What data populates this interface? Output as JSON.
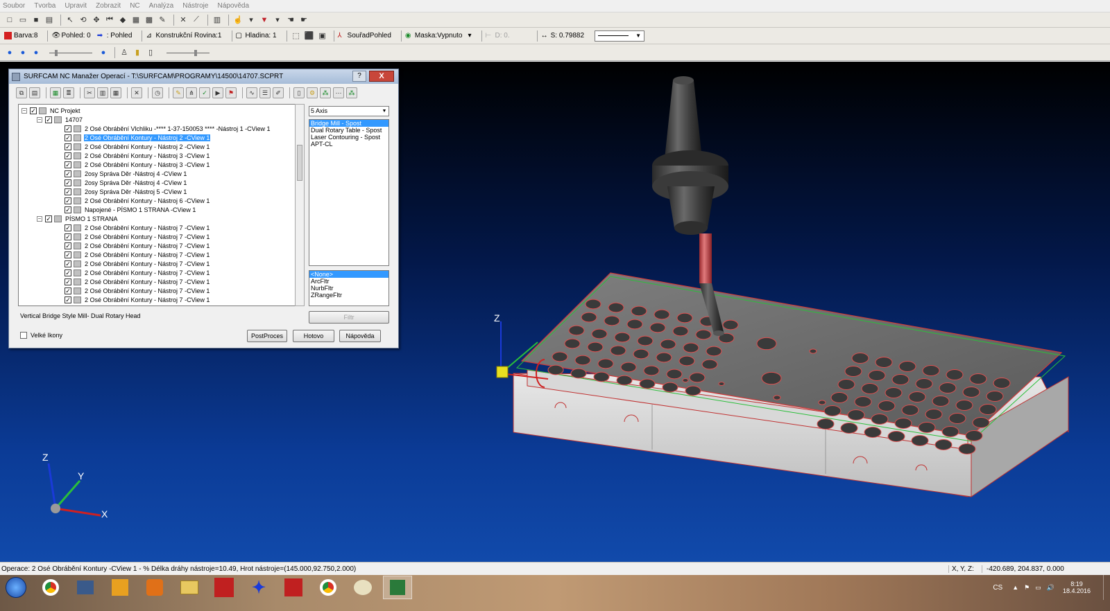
{
  "menu": [
    "Soubor",
    "Tvorba",
    "Upravit",
    "Zobrazit",
    "NC",
    "Analýza",
    "Nástroje",
    "Nápověda"
  ],
  "toolbar2": {
    "barva": "Barva:8",
    "pohled": "Pohled: 0",
    "pohled2": ": Pohled",
    "rovina": "Konstrukční Rovina:1",
    "hladina": "Hladina: 1",
    "soudad": "SouřadPohled",
    "maska": "Maska:Vypnuto",
    "d": "D: 0.",
    "s": "S: 0.79882"
  },
  "dialog": {
    "title": "SURFCAM NC Manažer Operací - T:\\SURFCAM\\PROGRAMY\\14500\\14707.SCPRT",
    "help": "?",
    "close": "X",
    "tree": {
      "root": "NC Projekt",
      "group1": "14707",
      "group1_ops": [
        "2 Osé Obrábění Vlchliku -**** 1-37-150053 **** -Nástroj 1 -CView 1",
        "2 Osé Obrábění Kontury - Nástroj 2 -CView 1",
        "2 Osé Obrábění Kontury - Nástroj 2 -CView 1",
        "2 Osé Obrábění Kontury - Nástroj 3 -CView 1",
        "2 Osé Obrábění Kontury - Nástroj 3 -CView 1",
        "2osy Správa Děr -Nástroj 4 -CView 1",
        "2osy Správa Děr -Nástroj 4 -CView 1",
        "2osy Správa Děr -Nástroj 5 -CView 1",
        "2 Osé Obrábění Kontury - Nástroj 6 -CView 1",
        "Napojené - PÍSMO 1 STRANA -CView 1"
      ],
      "group2": "PÍSMO 1 STRANA",
      "group2_ops": [
        "2 Osé Obrábění Kontury - Nástroj 7 -CView 1",
        "2 Osé Obrábění Kontury - Nástroj 7 -CView 1",
        "2 Osé Obrábění Kontury - Nástroj 7 -CView 1",
        "2 Osé Obrábění Kontury - Nástroj 7 -CView 1",
        "2 Osé Obrábění Kontury - Nástroj 7 -CView 1",
        "2 Osé Obrábění Kontury - Nástroj 7 -CView 1",
        "2 Osé Obrábění Kontury - Nástroj 7 -CView 1",
        "2 Osé Obrábění Kontury - Nástroj 7 -CView 1",
        "2 Osé Obrábění Kontury - Nástroj 7 -CView 1"
      ]
    },
    "axis_select": "5 Axis",
    "post_list": [
      "Bridge Mill - Spost",
      "Dual Rotary Table - Spost",
      "Laser Contouring - Spost",
      "APT-CL"
    ],
    "filter_list": [
      "<None>",
      "ArcFltr",
      "NurbFltr",
      "ZRangeFltr"
    ],
    "filtr_button": "Filtr",
    "description": "Vertical Bridge Style Mill- Dual Rotary Head",
    "big_icons": "Velké Ikony",
    "postproces": "PostProces",
    "hotovo": "Hotovo",
    "napoveda": "Nápověda"
  },
  "viewport": {
    "axis_labels": {
      "z": "Z",
      "y": "Y",
      "x": "X"
    }
  },
  "status": {
    "message": "Operace: 2 Osé Obrábění Kontury   -CView 1 - % Délka dráhy nástroje=10.49, Hrot nástroje=(145.000,92.750,2.000)",
    "coord_label": "X, Y, Z:",
    "coord_value": "-420.689, 204.837, 0.000"
  },
  "tray": {
    "lang": "CS",
    "time": "8:19",
    "date": "18.4.2016"
  },
  "colors": {
    "selection": "#3399ff",
    "tool_red": "#c8464a",
    "viewport_bottom": "#114aab"
  }
}
